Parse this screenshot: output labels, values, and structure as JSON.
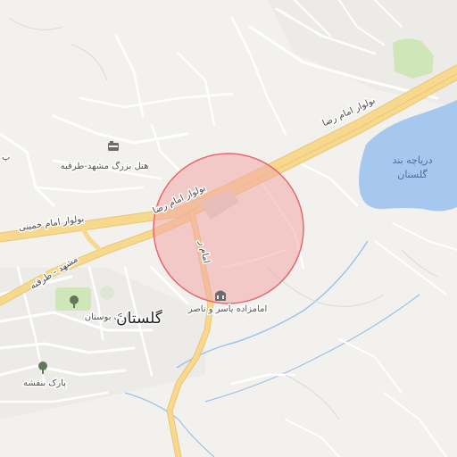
{
  "map": {
    "labels": {
      "road_emam_reza_upper": "بولوار امام رضا",
      "road_emam_reza_lower": "بولوار امام رضا",
      "road_emam_khomeini": "بولوار امام خمینی",
      "road_mashhad_torghabeh": "مشهد - طرقبه",
      "road_vertical": "امام ر"
    },
    "places": {
      "city": "گلستان",
      "hotel": "هتل بزرگ مشهد-طرقبه",
      "shrine": "امامزاده یاسر و ناصر",
      "park_bustan": "پارک بوستان",
      "park_banafsheh": "پارک بنفشه",
      "lake_line1": "دریاچه بند",
      "lake_line2": "گلستان",
      "edge_letter": "پ"
    },
    "colors": {
      "background": "#f3f1ed",
      "water": "#a7c8ee",
      "major_road": "#f7d88c",
      "minor_road": "#ffffff",
      "park": "#cfe7b8",
      "highlight_fill": "#f2a7aa",
      "highlight_stroke": "#e26a70",
      "stream": "#9cc3ec"
    }
  }
}
